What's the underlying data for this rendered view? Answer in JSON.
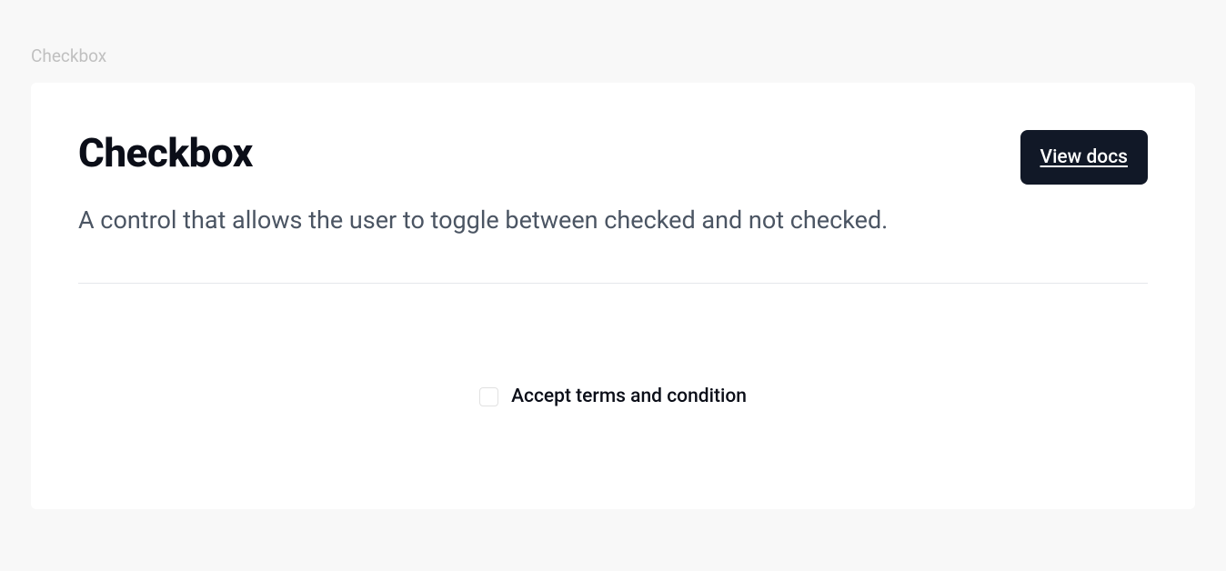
{
  "breadcrumb": {
    "label": "Checkbox"
  },
  "header": {
    "title": "Checkbox",
    "description": "A control that allows the user to toggle between checked and not checked.",
    "docs_button_label": "View docs"
  },
  "demo": {
    "checkbox": {
      "checked": false,
      "label": "Accept terms and condition"
    }
  }
}
